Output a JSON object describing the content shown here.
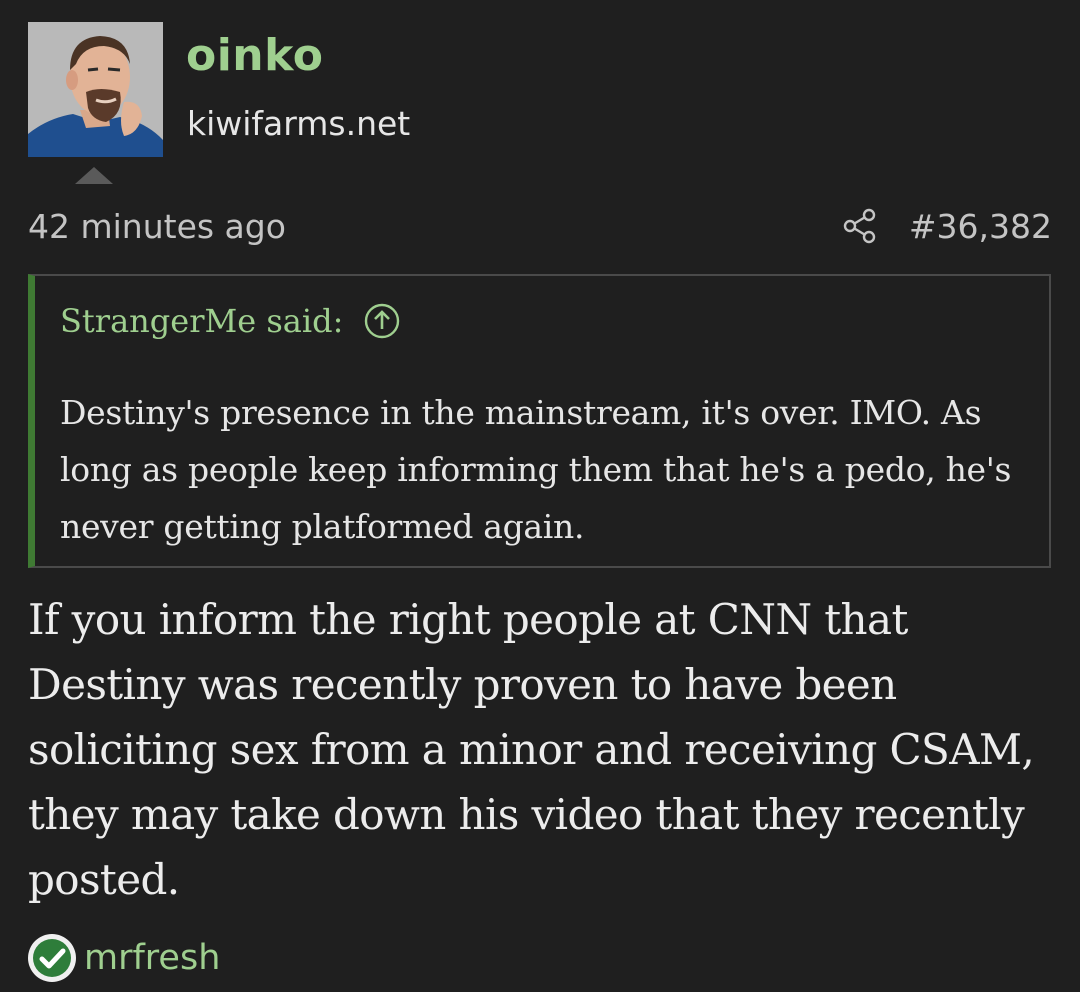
{
  "author": {
    "username": "oinko",
    "user_title": "kiwifarms.net",
    "avatar_icon": "avatar-illustration"
  },
  "post": {
    "time": "42 minutes ago",
    "number": "#36,382",
    "share_icon": "share-icon",
    "body": "If you inform the right people at CNN that Destiny was recently proven to have been soliciting sex from a minor and receiving CSAM, they may take down his video that they recently posted."
  },
  "quote": {
    "author_said": "StrangerMe said:",
    "jump_icon": "arrow-up-circle-icon",
    "text": "Destiny's presence in the mainstream, it's over. IMO. As long as people keep informing them that he's a pedo, he's never getting platformed again."
  },
  "reactions": {
    "icon": "checkmark-circle-icon",
    "users": "mrfresh"
  },
  "colors": {
    "background": "#1f1f1f",
    "username_green": "#9fcf8f",
    "quote_border_accent": "#3f7a33",
    "text": "#e6e6e6"
  }
}
